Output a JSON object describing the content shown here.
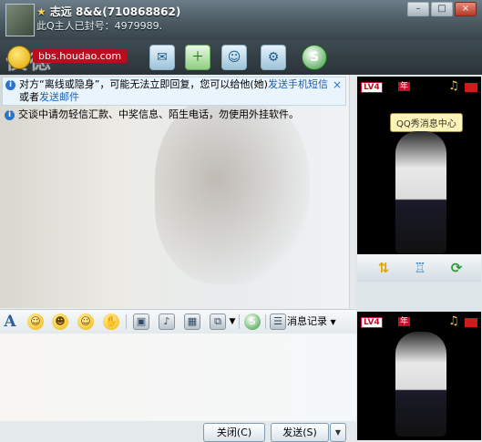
{
  "window": {
    "contact_name": "志远 8&&(710868862)",
    "contact_status": "此Q主人已封号：4979989.",
    "minimize_label": "–",
    "maximize_label": "□",
    "close_label": "×"
  },
  "toolbar": {
    "watermark_text": "侯德",
    "url_badge": "bbs.houdao.com"
  },
  "chat": {
    "notice1_prefix": "对方“离线或隐身”，可能无法立即回复，您可以给他(她)",
    "notice1_link1": "发送手机短信",
    "notice1_mid": "或者",
    "notice1_link2": "发送邮件",
    "notice1_close": "×",
    "notice2_text": "交谈中请勿轻信汇款、中奖信息、陌生电话，勿使用外挂软件。"
  },
  "format_bar": {
    "font_icon": "A",
    "history_label": "消息记录"
  },
  "buttons": {
    "close_label": "关闭(C)",
    "send_label": "发送(S)"
  },
  "right_panel": {
    "badge_level": "LV4",
    "badge_year": "年",
    "tooltip_text": "QQ秀消息中心"
  }
}
